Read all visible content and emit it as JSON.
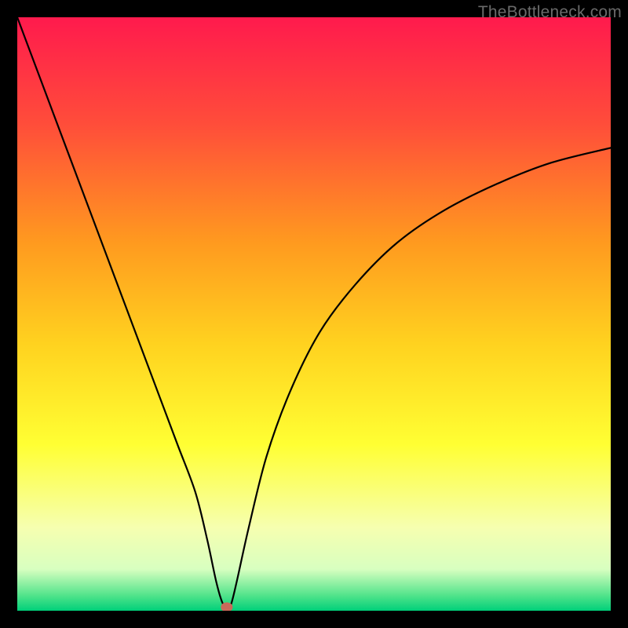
{
  "watermark": "TheBottleneck.com",
  "chart_data": {
    "type": "line",
    "title": "",
    "xlabel": "",
    "ylabel": "",
    "xlim": [
      0,
      100
    ],
    "ylim": [
      0,
      100
    ],
    "grid": false,
    "legend": false,
    "background_gradient_stops": [
      {
        "offset": 0.0,
        "color": "#ff1a4d"
      },
      {
        "offset": 0.18,
        "color": "#ff4d3a"
      },
      {
        "offset": 0.38,
        "color": "#ff9a1f"
      },
      {
        "offset": 0.55,
        "color": "#ffd21f"
      },
      {
        "offset": 0.72,
        "color": "#ffff33"
      },
      {
        "offset": 0.86,
        "color": "#f6ffb0"
      },
      {
        "offset": 0.93,
        "color": "#d8ffc0"
      },
      {
        "offset": 0.975,
        "color": "#4fe38a"
      },
      {
        "offset": 1.0,
        "color": "#00d07a"
      }
    ],
    "series": [
      {
        "name": "bottleneck-curve",
        "color": "#000000",
        "stroke_width": 2.2,
        "x": [
          0,
          3,
          6,
          9,
          12,
          15,
          18,
          21,
          24,
          27,
          30,
          32,
          33.5,
          34.5,
          35.3,
          36,
          37,
          39,
          42,
          46,
          51,
          57,
          64,
          72,
          81,
          90,
          100
        ],
        "y": [
          100,
          92,
          84,
          76,
          68,
          60,
          52,
          44,
          36,
          28,
          20,
          12,
          5,
          1.5,
          0.3,
          1.0,
          5,
          14,
          26,
          37,
          47,
          55,
          62,
          67.5,
          72,
          75.5,
          78
        ]
      }
    ],
    "marker": {
      "name": "optimum-point",
      "x": 35.3,
      "y": 0.6,
      "rx": 1.0,
      "ry": 0.8,
      "color": "#c96a5a"
    }
  }
}
